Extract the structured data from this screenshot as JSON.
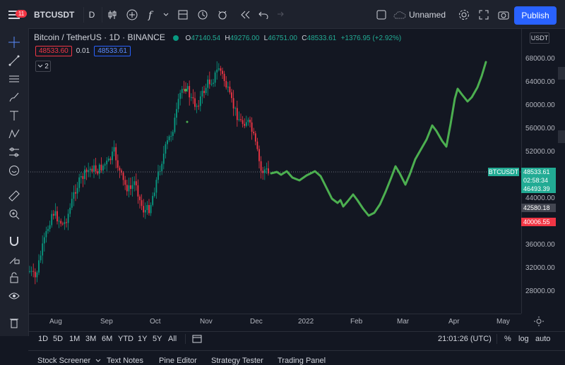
{
  "toolbar": {
    "menu_badge": "11",
    "symbol": "BTCUSDT",
    "interval": "D",
    "layout_name": "Unnamed",
    "publish_label": "Publish"
  },
  "legend": {
    "title": "Bitcoin / TetherUS · 1D · BINANCE",
    "open_label": "O",
    "open": "47140.54",
    "high_label": "H",
    "high": "49276.00",
    "low_label": "L",
    "low": "46751.00",
    "close_label": "C",
    "close": "48533.61",
    "change": "+1376.95 (+2.92%)"
  },
  "trade": {
    "sell_price": "48533.60",
    "spread": "0.01",
    "buy_price": "48533.61",
    "collapse_count": "2"
  },
  "price_axis": {
    "currency": "USDT",
    "ticks": [
      "68000.00",
      "64000.00",
      "60000.00",
      "56000.00",
      "52000.00",
      "44000.00",
      "36000.00",
      "32000.00",
      "28000.00"
    ],
    "last_price": "48533.61",
    "countdown": "02:58:34",
    "level_1": "46493.39",
    "level_2": "42580.18",
    "level_3": "40006.55",
    "symbol_label": "BTCUSDT"
  },
  "time_axis": {
    "ticks": [
      "Aug",
      "Sep",
      "Oct",
      "Nov",
      "Dec",
      "2022",
      "Feb",
      "Mar",
      "Apr",
      "May"
    ]
  },
  "ranges": [
    "1D",
    "5D",
    "1M",
    "3M",
    "6M",
    "YTD",
    "1Y",
    "5Y",
    "All"
  ],
  "clock": "21:01:26 (UTC)",
  "scale_options": {
    "percent": "%",
    "log": "log",
    "auto": "auto"
  },
  "bottom_tabs": [
    "Stock Screener",
    "Text Notes",
    "Pine Editor",
    "Strategy Tester",
    "Trading Panel"
  ],
  "colors": {
    "up": "#089981",
    "down": "#f23645",
    "forecast": "#4caf50",
    "accent": "#2962ff"
  },
  "icons": {
    "left_toolbar": [
      "crosshair-icon",
      "trend-line-icon",
      "horizontal-lines-icon",
      "brush-icon",
      "text-icon",
      "pattern-icon",
      "forecast-icon",
      "emoji-icon",
      "ruler-icon",
      "zoom-icon",
      "magnet-icon",
      "lock-drawing-icon",
      "lock-icon",
      "eye-icon",
      "trash-icon"
    ]
  }
}
